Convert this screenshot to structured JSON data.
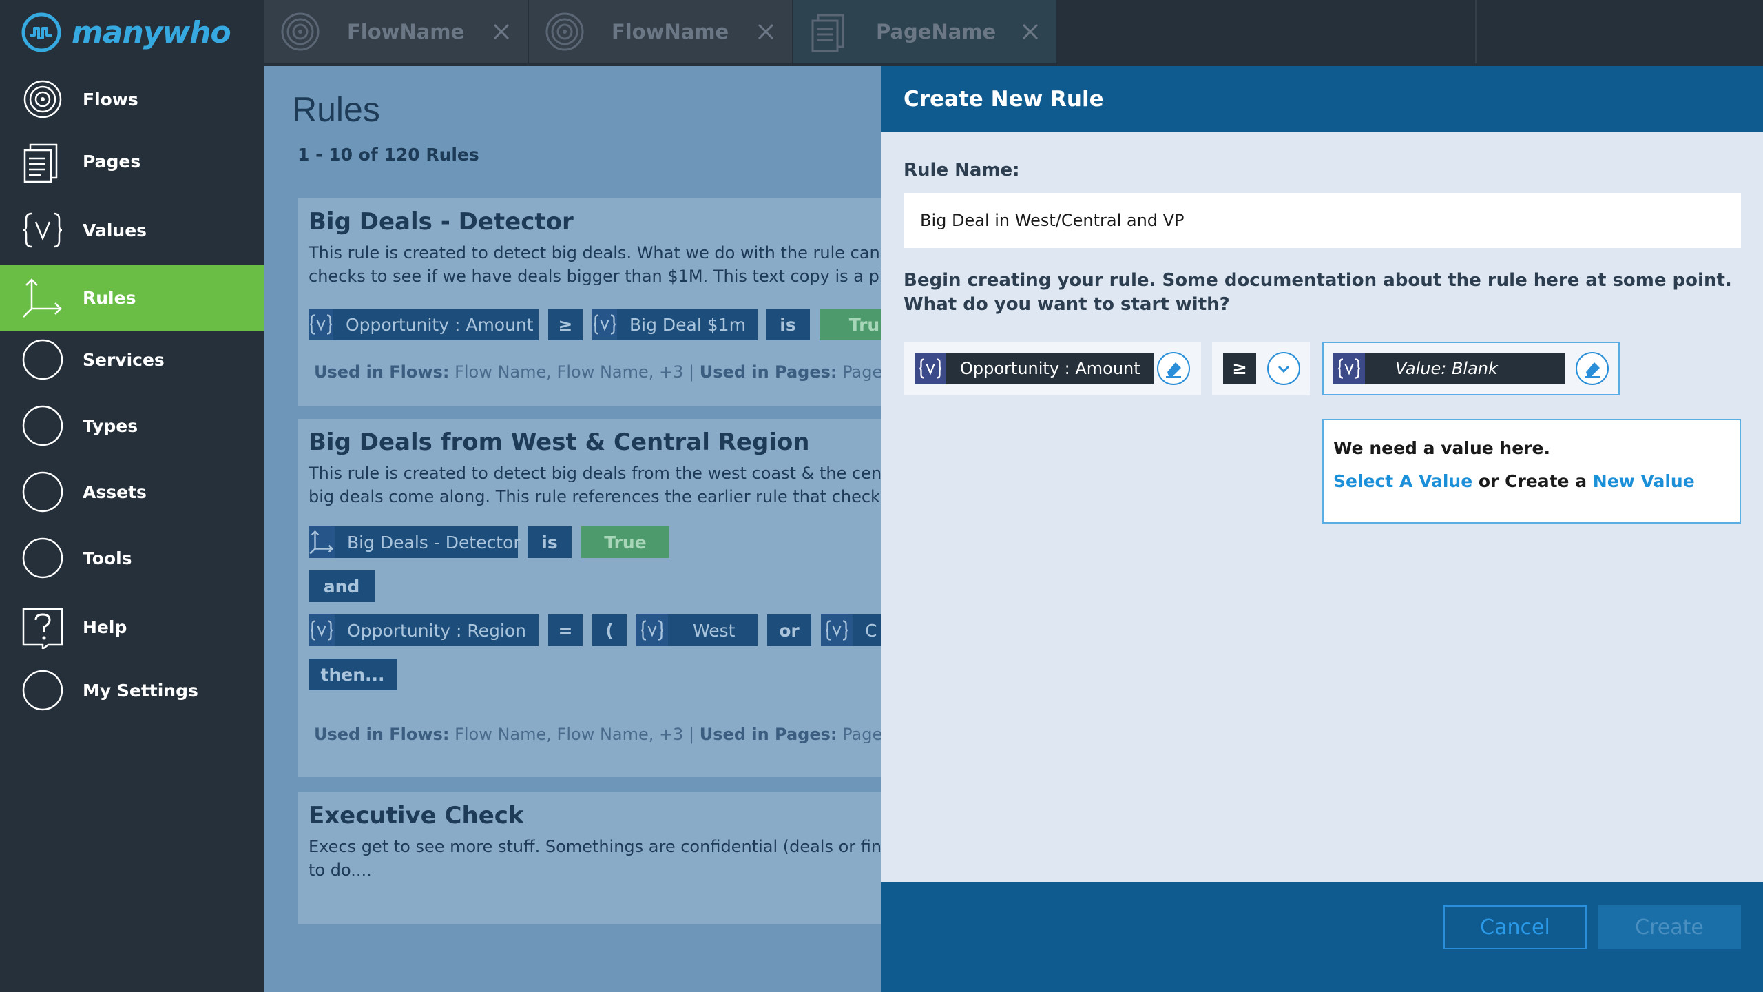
{
  "app": {
    "logo_text": "manywho",
    "brand_color": "#36a9e1"
  },
  "sidebar": {
    "items": [
      {
        "label": "Flows",
        "icon": "flows-icon"
      },
      {
        "label": "Pages",
        "icon": "pages-icon"
      },
      {
        "label": "Values",
        "icon": "values-icon"
      },
      {
        "label": "Rules",
        "icon": "rules-icon",
        "active": true
      },
      {
        "label": "Services",
        "icon": "circle-icon"
      },
      {
        "label": "Types",
        "icon": "circle-icon"
      },
      {
        "label": "Assets",
        "icon": "circle-icon"
      },
      {
        "label": "Tools",
        "icon": "circle-icon"
      },
      {
        "label": "Help",
        "icon": "help-icon"
      },
      {
        "label": "My Settings",
        "icon": "circle-icon"
      }
    ],
    "active_color": "#6abd45"
  },
  "tabs": [
    {
      "label": "FlowName",
      "icon": "flow-icon"
    },
    {
      "label": "FlowName",
      "icon": "flow-icon"
    },
    {
      "label": "PageName",
      "icon": "page-icon",
      "active": true
    }
  ],
  "main": {
    "title": "Rules",
    "count": "1 - 10 of 120 Rules",
    "cards": [
      {
        "title": "Big Deals - Detector",
        "desc_lines": [
          "This rule is created to detect big deals. What we do with the rule can be be",
          "checks to see if we have deals bigger than $1M. This text copy is a placehol"
        ],
        "chips": [
          "Opportunity : Amount",
          "≥",
          "Big Deal $1m",
          "is",
          "Tru"
        ],
        "usage_flows_label": "Used in Flows:",
        "usage_flows": "Flow Name, Flow Name, +3",
        "usage_sep": "|",
        "usage_pages_label": "Used in Pages:",
        "usage_pages": "Page Name, P"
      },
      {
        "title": "Big Deals from West & Central Region",
        "desc_lines": [
          "This rule is created to detect big deals from the west coast & the central reg",
          "big deals come along. This rule references the earlier rule that checks the s"
        ],
        "chips": [
          "Big Deals - Detector",
          "is",
          "True",
          "and",
          "Opportunity : Region",
          "=",
          "(",
          "West",
          "or",
          "C",
          "then..."
        ],
        "usage_flows_label": "Used in Flows:",
        "usage_flows": "Flow Name, Flow Name, +3",
        "usage_sep": "|",
        "usage_pages_label": "Used in Pages:",
        "usage_pages": "Page Name, P"
      },
      {
        "title": "Executive Check",
        "desc_lines": [
          "Execs get to see more stuff. Somethings are confidential (deals or financial)",
          "to do...."
        ]
      }
    ]
  },
  "modal": {
    "title": "Create New Rule",
    "rule_name_label": "Rule Name:",
    "rule_name_value": "Big Deal in West/Central and VP",
    "help_lines": [
      "Begin creating your rule. Some documentation about the rule here at some point.",
      "What do you want to start with?"
    ],
    "left_value": "Opportunity : Amount",
    "operator": "≥",
    "right_value": "Value: Blank",
    "popover": {
      "line1": "We need a value here.",
      "link1": "Select A Value",
      "mid": " or Create a ",
      "link2": "New Value"
    },
    "cancel_label": "Cancel",
    "create_label": "Create"
  }
}
